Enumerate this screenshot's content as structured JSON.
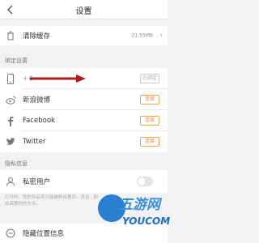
{
  "header": {
    "title": "设置"
  },
  "cache": {
    "label": "清除缓存",
    "size": "21.55MB",
    "chevron": "›"
  },
  "bind_section": {
    "title": "绑定设置"
  },
  "phone": {
    "masked": "+8",
    "button": "已绑定"
  },
  "weibo": {
    "label": "新浪微博",
    "button": "连接"
  },
  "facebook": {
    "label": "Facebook",
    "button": "连接"
  },
  "twitter": {
    "label": "Twitter",
    "button": "连接"
  },
  "privacy_section": {
    "title": "隐私信息"
  },
  "private_user": {
    "label": "私密用户",
    "toggle_on": false
  },
  "note": {
    "text": "打开时，你的作品将只能被粉丝看到，并且...粉丝需要你的允许。"
  },
  "hide_location": {
    "label": "隐藏位置信息"
  },
  "watermark": {
    "line1": "五游网",
    "line2": "YOUCOM"
  },
  "colors": {
    "accent": "#e8833a",
    "annotation_arrow": "#b11b1b",
    "watermark": "#2b7fd0"
  },
  "icons": [
    "back-arrow-icon",
    "trash-icon",
    "phone-icon",
    "weibo-icon",
    "facebook-icon",
    "twitter-icon",
    "user-icon",
    "location-icon"
  ]
}
